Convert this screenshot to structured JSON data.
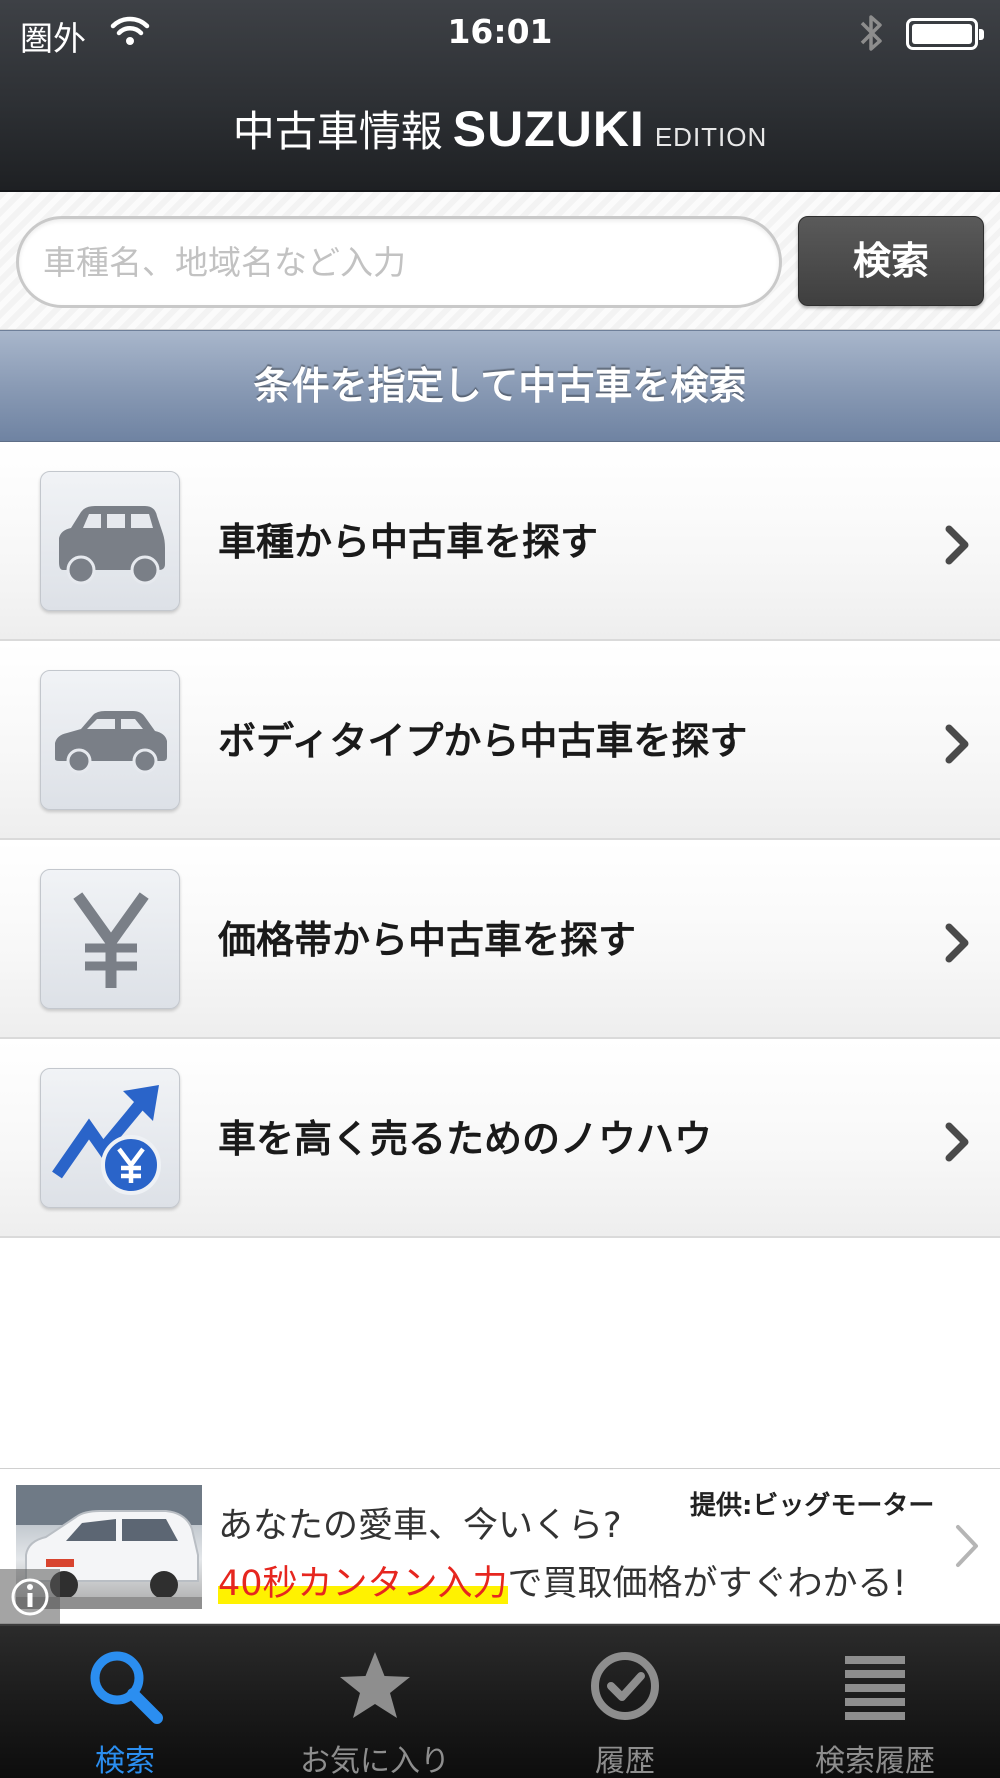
{
  "status_bar": {
    "carrier": "圏外",
    "time": "16:01"
  },
  "header": {
    "title_jp": "中古車情報",
    "title_brand": "SUZUKI",
    "title_edition": "EDITION"
  },
  "search": {
    "placeholder": "車種名、地域名など入力",
    "value": "",
    "button_label": "検索"
  },
  "section": {
    "title": "条件を指定して中古車を検索"
  },
  "menu": {
    "items": [
      {
        "label": "車種から中古車を探す",
        "icon": "car-model-icon"
      },
      {
        "label": "ボディタイプから中古車を探す",
        "icon": "body-type-icon"
      },
      {
        "label": "価格帯から中古車を探す",
        "icon": "yen-icon"
      },
      {
        "label": "車を高く売るためのノウハウ",
        "icon": "value-up-icon"
      }
    ]
  },
  "ad": {
    "provider": "提供:ビッグモーター",
    "line1": "あなたの愛車、今いくら?",
    "line2_highlight": "40秒カンタン入力",
    "line2_rest": "で買取価格がすぐわかる!"
  },
  "tabs": [
    {
      "label": "検索",
      "icon": "search-icon",
      "active": true
    },
    {
      "label": "お気に入り",
      "icon": "star-icon",
      "active": false
    },
    {
      "label": "履歴",
      "icon": "check-circle-icon",
      "active": false
    },
    {
      "label": "検索履歴",
      "icon": "list-icon",
      "active": false
    }
  ],
  "colors": {
    "accent": "#2b8ef0",
    "header_bg": "#2d3034",
    "section_bg": "#8a9bb5",
    "ad_highlight": "#e6261f"
  }
}
